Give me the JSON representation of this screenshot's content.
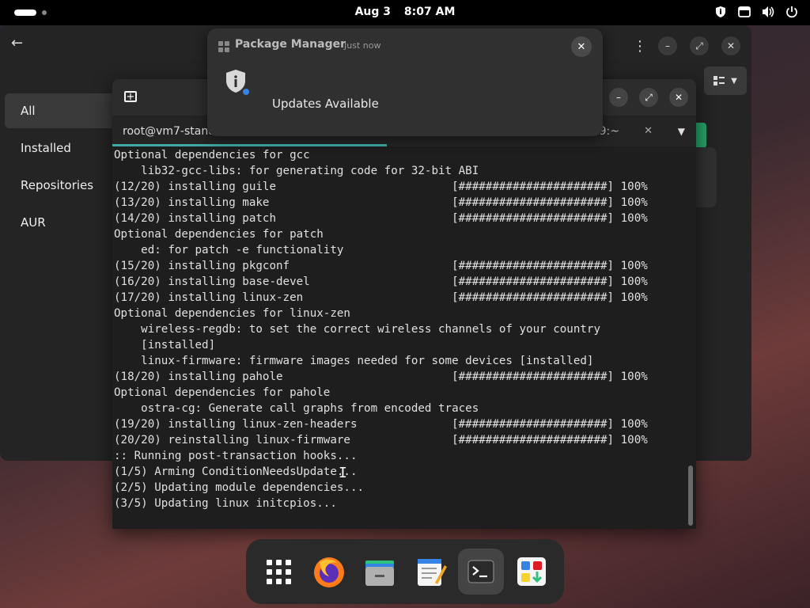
{
  "topbar": {
    "date": "Aug 3",
    "time": "8:07 AM",
    "tray_icons": [
      "security-shield-icon",
      "screen-icon",
      "volume-icon",
      "power-icon"
    ]
  },
  "package_manager": {
    "sidebar": [
      {
        "label": "All",
        "active": true
      },
      {
        "label": "Installed",
        "active": false
      },
      {
        "label": "Repositories",
        "active": false
      },
      {
        "label": "AUR",
        "active": false
      }
    ]
  },
  "notification": {
    "app_name": "Package Manager",
    "time": "Just now",
    "body": "Updates Available"
  },
  "terminal": {
    "tabs": [
      {
        "label": "root@vm7-stand",
        "active": true
      },
      {
        "label": "009:~",
        "active": false
      }
    ],
    "lines": [
      "Optional dependencies for gcc",
      "    lib32-gcc-libs: for generating code for 32-bit ABI",
      "(12/20) installing guile                          [######################] 100%",
      "(13/20) installing make                           [######################] 100%",
      "(14/20) installing patch                          [######################] 100%",
      "Optional dependencies for patch",
      "    ed: for patch -e functionality",
      "(15/20) installing pkgconf                        [######################] 100%",
      "(16/20) installing base-devel                     [######################] 100%",
      "(17/20) installing linux-zen                      [######################] 100%",
      "Optional dependencies for linux-zen",
      "    wireless-regdb: to set the correct wireless channels of your country",
      "    [installed]",
      "    linux-firmware: firmware images needed for some devices [installed]",
      "(18/20) installing pahole                         [######################] 100%",
      "Optional dependencies for pahole",
      "    ostra-cg: Generate call graphs from encoded traces",
      "(19/20) installing linux-zen-headers              [######################] 100%",
      "(20/20) reinstalling linux-firmware               [######################] 100%",
      ":: Running post-transaction hooks...",
      "(1/5) Arming ConditionNeedsUpdate...",
      "(2/5) Updating module dependencies...",
      "(3/5) Updating linux initcpios..."
    ]
  },
  "dock": {
    "items": [
      {
        "name": "app-grid-icon",
        "active": false
      },
      {
        "name": "firefox-icon",
        "active": false
      },
      {
        "name": "files-icon",
        "active": false
      },
      {
        "name": "text-editor-icon",
        "active": false
      },
      {
        "name": "terminal-icon",
        "active": true
      },
      {
        "name": "software-store-icon",
        "active": false
      }
    ]
  }
}
